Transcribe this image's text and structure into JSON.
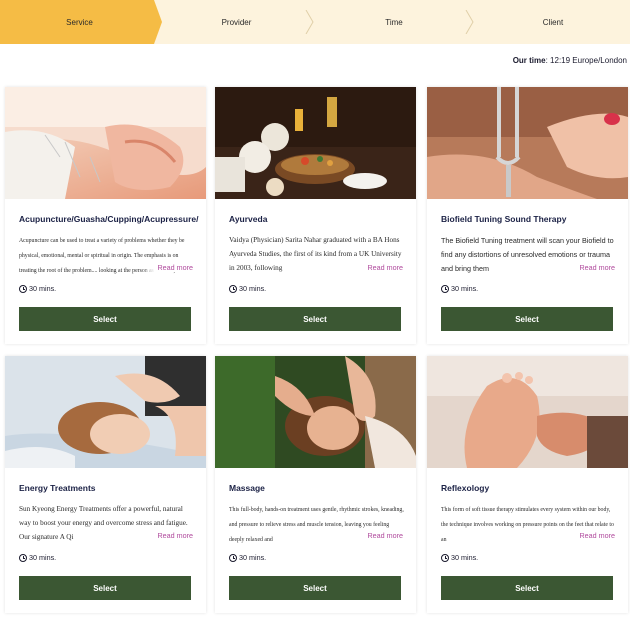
{
  "stepper": {
    "steps": [
      "Service",
      "Provider",
      "Time",
      "Client"
    ],
    "active_color": "#f5bc45",
    "inactive_color": "#fdf3dd"
  },
  "timezone": {
    "label": "Our time",
    "value": ": 12:19 Europe/London"
  },
  "read_more_label": "Read more",
  "select_label": "Select",
  "accent_button_color": "#3b5733",
  "services": [
    {
      "title": "Acupuncture/Guasha/Cupping/Acupressure/",
      "description": "Acupuncture can be used to treat a variety of problems whether they be physical, emotional, mental or spiritual in origin. The emphasis is on treating the root of the problem.... looking at the person as a whole, and restoring",
      "duration": "30 mins.",
      "image": "acupuncture-photo"
    },
    {
      "title": "Ayurveda",
      "description": "Vaidya (Physician) Sarita Nahar graduated with a BA Hons Ayurveda Studies, the first of its kind from a UK University in 2003, following",
      "duration": "30 mins.",
      "image": "ayurveda-photo"
    },
    {
      "title": "Biofield Tuning Sound Therapy",
      "description": "The Biofield Tuning treatment will scan your Biofield to find any distortions of unresolved emotions or trauma and bring them",
      "duration": "30 mins.",
      "image": "tuning-fork-photo"
    },
    {
      "title": "Energy Treatments",
      "description": "Sun Kyeong Energy Treatments offer a powerful, natural way to boost your energy and overcome stress and fatigue. Our signature A Qi",
      "duration": "30 mins.",
      "image": "energy-treatment-photo"
    },
    {
      "title": "Massage",
      "description": "This full-body, hands-on treatment uses gentle, rhythmic strokes, kneading, and pressure to relieve stress and muscle tension, leaving you feeling deeply relaxed and",
      "duration": "30 mins.",
      "image": "massage-photo"
    },
    {
      "title": "Reflexology",
      "description": "This form of soft tissue therapy stimulates every system within our body, the technique involves working on pressure points on the feet that relate to an",
      "duration": "30 mins.",
      "image": "reflexology-photo"
    }
  ]
}
